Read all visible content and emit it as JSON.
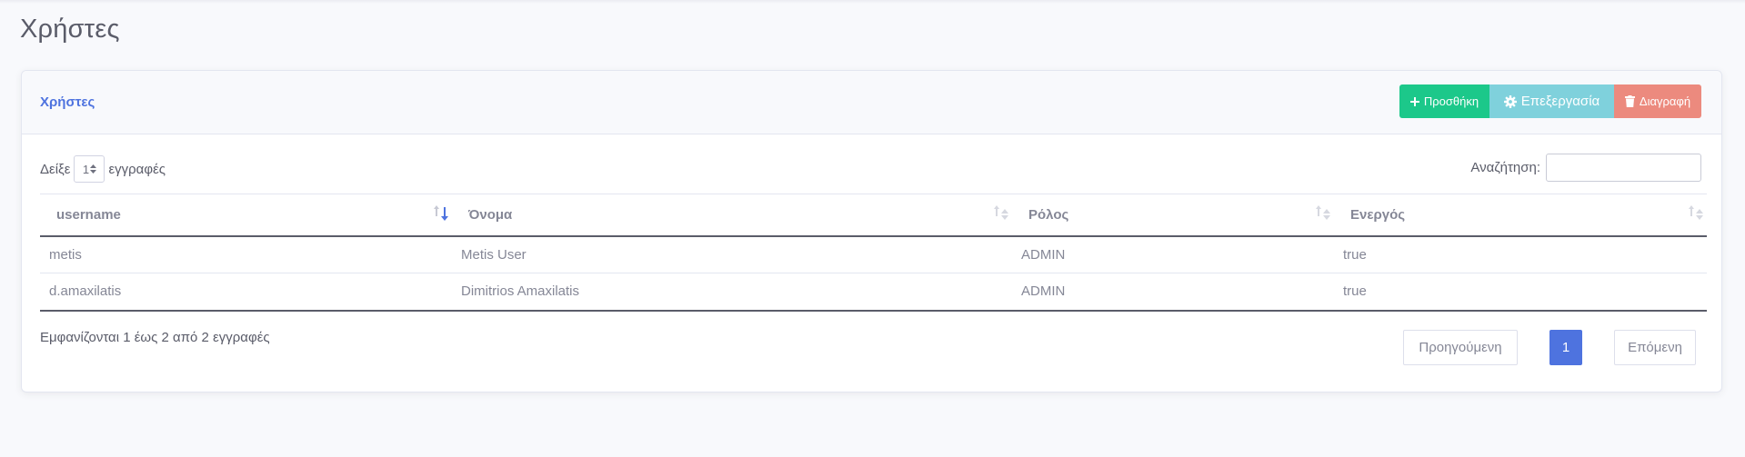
{
  "page": {
    "title": "Χρήστες"
  },
  "card": {
    "title": "Χρήστες",
    "buttons": {
      "add": "Προσθήκη",
      "edit": "Επεξεργασία",
      "delete": "Διαγραφή"
    }
  },
  "table_controls": {
    "show_label": "Δείξε",
    "length_value": "1",
    "records_label": "εγγραφές",
    "search_label": "Αναζήτηση:",
    "search_value": ""
  },
  "table": {
    "headers": [
      "username",
      "Όνομα",
      "Ρόλος",
      "Ενεργός"
    ],
    "sorted_column": "username",
    "rows": [
      [
        "metis",
        "Metis User",
        "ADMIN",
        "true"
      ],
      [
        "d.amaxilatis",
        "Dimitrios Amaxilatis",
        "ADMIN",
        "true"
      ]
    ]
  },
  "footer": {
    "info": "Εμφανίζονται 1 έως 2 από 2 εγγραφές",
    "prev": "Προηγούμενη",
    "current_page": "1",
    "next": "Επόμενη"
  },
  "colors": {
    "primary": "#4e73df",
    "success": "#1cc88a",
    "info": "#7fd1dc",
    "danger": "#ec8a7e"
  },
  "icons": [
    "plus-icon",
    "gear-icon",
    "trash-icon",
    "sort-icon",
    "sort-desc-icon"
  ]
}
